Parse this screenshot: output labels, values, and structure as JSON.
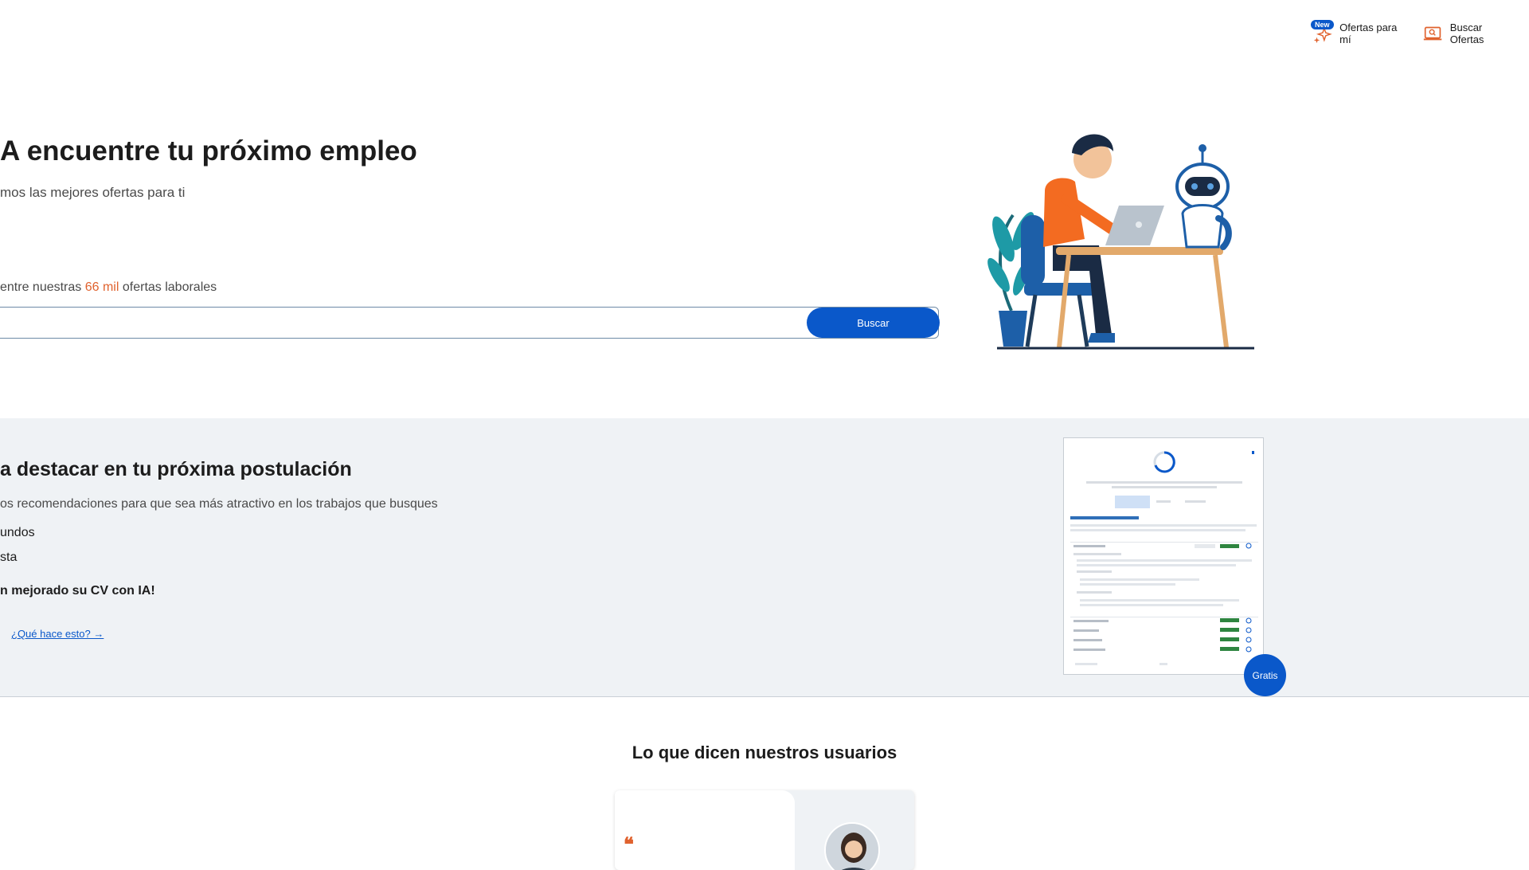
{
  "nav": {
    "new_badge": "New",
    "ofertas_para_mi": "Ofertas para mí",
    "buscar_ofertas": "Buscar Ofertas"
  },
  "hero": {
    "title": "A encuentre tu próximo empleo",
    "subtitle": "mos las mejores ofertas para ti",
    "caption_prefix": "entre nuestras ",
    "caption_count": "66 mil",
    "caption_suffix": " ofertas laborales",
    "search_value": "",
    "search_button": "Buscar"
  },
  "cv": {
    "title": "a destacar en tu próxima postulación",
    "subtitle": "os recomendaciones para que sea más atractivo en los trabajos que busques",
    "bullet1": "undos",
    "bullet2": "sta",
    "bullet3": "n mejorado su CV con IA!",
    "link": "¿Qué hace esto? →",
    "badge": "Gratis"
  },
  "testimonials": {
    "title": "Lo que dicen nuestros usuarios",
    "quote_mark": "❝"
  },
  "colors": {
    "primary": "#0a58ca",
    "accent": "#e0622e",
    "section_bg": "#eff2f5"
  }
}
